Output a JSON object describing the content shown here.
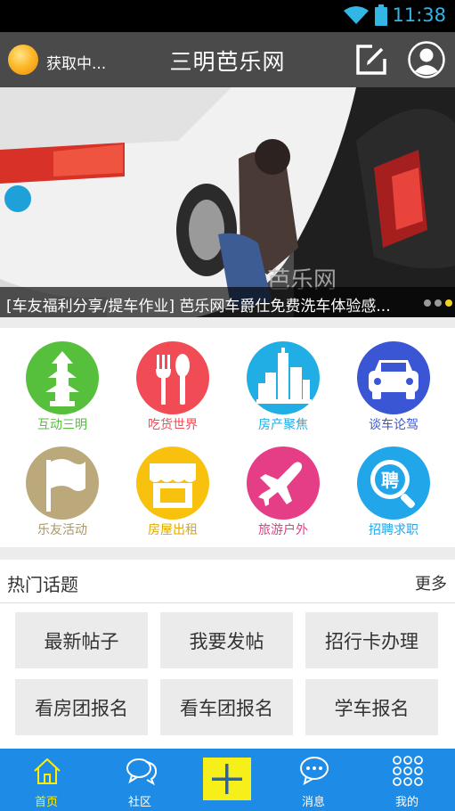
{
  "status_bar": {
    "time": "11:38"
  },
  "header": {
    "weather_text": "获取中...",
    "title": "三明芭乐网"
  },
  "banner": {
    "caption": "[车友福利分享/提车作业] 芭乐网车爵仕免费洗车体验感...",
    "watermark": "芭乐网",
    "slide_count": 3,
    "active_slide": 3
  },
  "categories": [
    {
      "label": "互动三明",
      "color": "#56c03c",
      "icon": "pagoda-icon"
    },
    {
      "label": "吃货世界",
      "color": "#f14b55",
      "icon": "fork-spoon-icon"
    },
    {
      "label": "房产聚焦",
      "color": "#20aee5",
      "icon": "buildings-icon"
    },
    {
      "label": "谈车论驾",
      "color": "#3a56d4",
      "icon": "car-icon"
    },
    {
      "label": "乐友活动",
      "color": "#bba97c",
      "icon": "flag-icon"
    },
    {
      "label": "房屋出租",
      "color": "#f8c10d",
      "icon": "storefront-icon"
    },
    {
      "label": "旅游户外",
      "color": "#e53e86",
      "icon": "airplane-icon"
    },
    {
      "label": "招聘求职",
      "color": "#22a6ea",
      "icon": "hire-search-icon"
    }
  ],
  "hot_topics": {
    "title": "热门话题",
    "more": "更多",
    "buttons": [
      "最新帖子",
      "我要发帖",
      "招行卡办理",
      "看房团报名",
      "看车团报名",
      "学车报名"
    ]
  },
  "tabbar": {
    "items": [
      "首页",
      "社区",
      "消息",
      "我的"
    ],
    "active": "首页",
    "active_color": "#ffee00",
    "bar_color": "#1e8ce6"
  }
}
